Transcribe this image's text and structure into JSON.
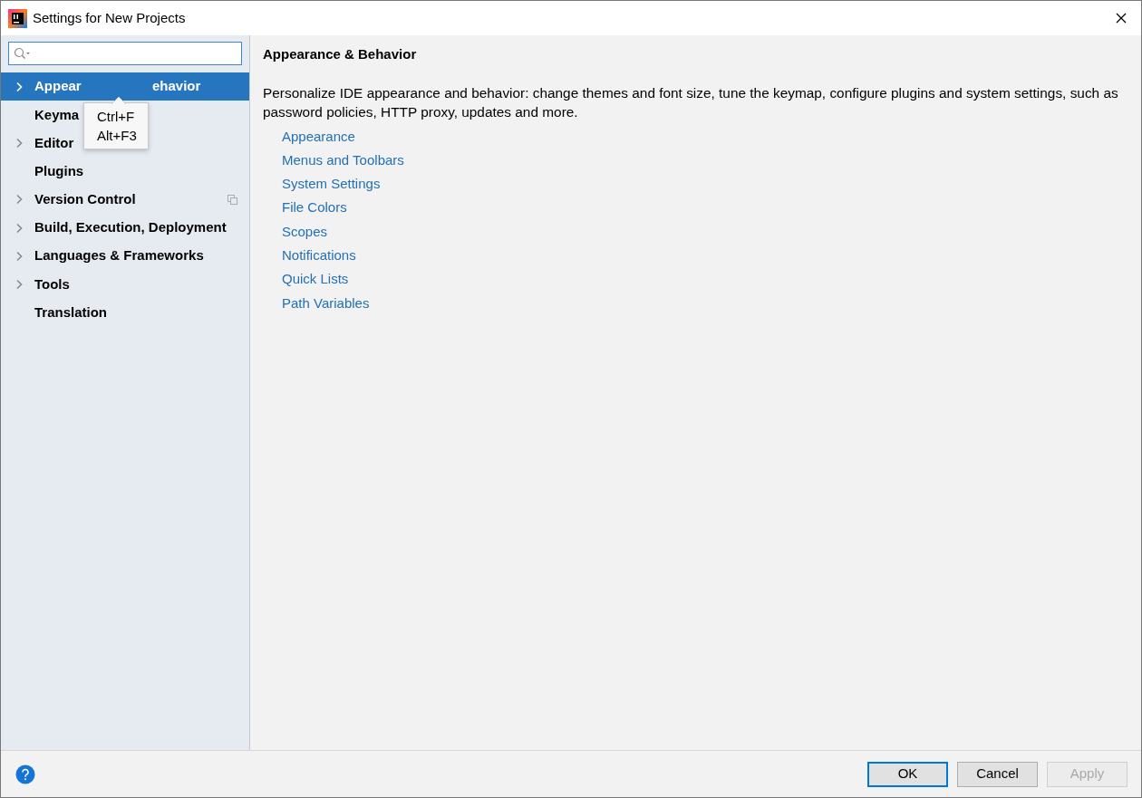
{
  "window": {
    "title": "Settings for New Projects"
  },
  "tooltip": {
    "lines": [
      "Ctrl+F",
      "Alt+F3"
    ]
  },
  "sidebar": {
    "items": [
      {
        "label": "Appear",
        "label_tail": "ehavior",
        "expandable": true,
        "selected": true
      },
      {
        "label": "Keyma",
        "selected": false
      },
      {
        "label": "Editor",
        "expandable": true,
        "selected": false
      },
      {
        "label": "Plugins",
        "selected": false
      },
      {
        "label": "Version Control",
        "expandable": true,
        "selected": false,
        "badge": true
      },
      {
        "label": "Build, Execution, Deployment",
        "expandable": true,
        "selected": false
      },
      {
        "label": "Languages & Frameworks",
        "expandable": true,
        "selected": false
      },
      {
        "label": "Tools",
        "expandable": true,
        "selected": false
      },
      {
        "label": "Translation",
        "selected": false
      }
    ]
  },
  "content": {
    "heading": "Appearance & Behavior",
    "description": "Personalize IDE appearance and behavior: change themes and font size, tune the keymap, configure plugins and system settings, such as password policies, HTTP proxy, updates and more.",
    "links": [
      "Appearance",
      "Menus and Toolbars",
      "System Settings",
      "File Colors",
      "Scopes",
      "Notifications",
      "Quick Lists",
      "Path Variables"
    ]
  },
  "buttons": [
    {
      "label": "OK",
      "kind": "default",
      "disabled": false
    },
    {
      "label": "Cancel",
      "kind": "normal",
      "disabled": false
    },
    {
      "label": "Apply",
      "kind": "normal",
      "disabled": true
    }
  ]
}
